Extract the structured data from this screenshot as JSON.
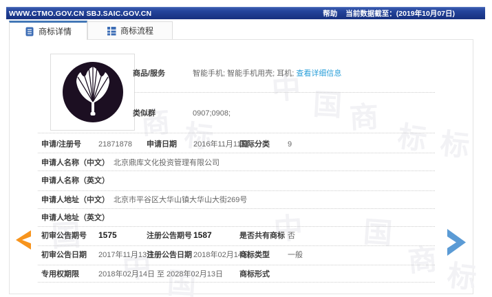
{
  "topbar": {
    "title": "WWW.CTMO.GOV.CN SBJ.SAIC.GOV.CN",
    "help_label": "帮助",
    "data_date": "当前数据截至：(2019年10月07日)"
  },
  "tabs": [
    {
      "label": "商标详情",
      "icon": "document-icon",
      "active": true
    },
    {
      "label": "商标流程",
      "icon": "list-icon",
      "active": false
    }
  ],
  "trademark_image": {
    "description": "dark circular logo with white folding-fan / shuttlecock emblem"
  },
  "goods": {
    "label": "商品/服务",
    "value": "智能手机; 智能手机用壳; 耳机;",
    "detail_link": "查看详细信息"
  },
  "similar_group": {
    "label": "类似群",
    "value": "0907;0908;"
  },
  "fields": {
    "app_reg_no": {
      "label": "申请/注册号",
      "value": "21871878"
    },
    "app_date": {
      "label": "申请日期",
      "value": "2016年11月11日"
    },
    "intl_class": {
      "label": "国际分类",
      "value": "9"
    },
    "applicant_name_cn": {
      "label": "申请人名称（中文）",
      "value": "北京鼎库文化投资管理有限公司"
    },
    "applicant_name_en": {
      "label": "申请人名称（英文）",
      "value": ""
    },
    "applicant_addr_cn": {
      "label": "申请人地址（中文）",
      "value": "北京市平谷区大华山镇大华山大街269号"
    },
    "applicant_addr_en": {
      "label": "申请人地址（英文）",
      "value": ""
    },
    "prelim_gazette_no": {
      "label": "初审公告期号",
      "value": "1575"
    },
    "reg_gazette_no": {
      "label": "注册公告期号",
      "value": "1587"
    },
    "shared_trademark": {
      "label": "是否共有商标",
      "value": "否"
    },
    "prelim_gazette_date": {
      "label": "初审公告日期",
      "value": "2017年11月13日"
    },
    "reg_gazette_date": {
      "label": "注册公告日期",
      "value": "2018年02月14日"
    },
    "trademark_type": {
      "label": "商标类型",
      "value": "一般"
    },
    "exclusive_period": {
      "label": "专用权期限",
      "value": "2018年02月14日 至 2028年02月13日"
    },
    "trademark_form": {
      "label": "商标形式",
      "value": ""
    }
  },
  "watermark": {
    "chars": [
      "中",
      "国",
      "商",
      "标"
    ]
  },
  "icons": {
    "tab_detail": "document-icon",
    "tab_process": "list-icon",
    "prev": "chevron-left-icon",
    "next": "chevron-right-icon"
  },
  "colors": {
    "topbar_blue": "#1c3a8e",
    "tab_accent_blue": "#4377b6",
    "link_blue": "#2b9fd9",
    "arrow_orange": "#F7941D",
    "arrow_blue": "#5B9BD5",
    "logo_dark": "#1c0f22"
  }
}
